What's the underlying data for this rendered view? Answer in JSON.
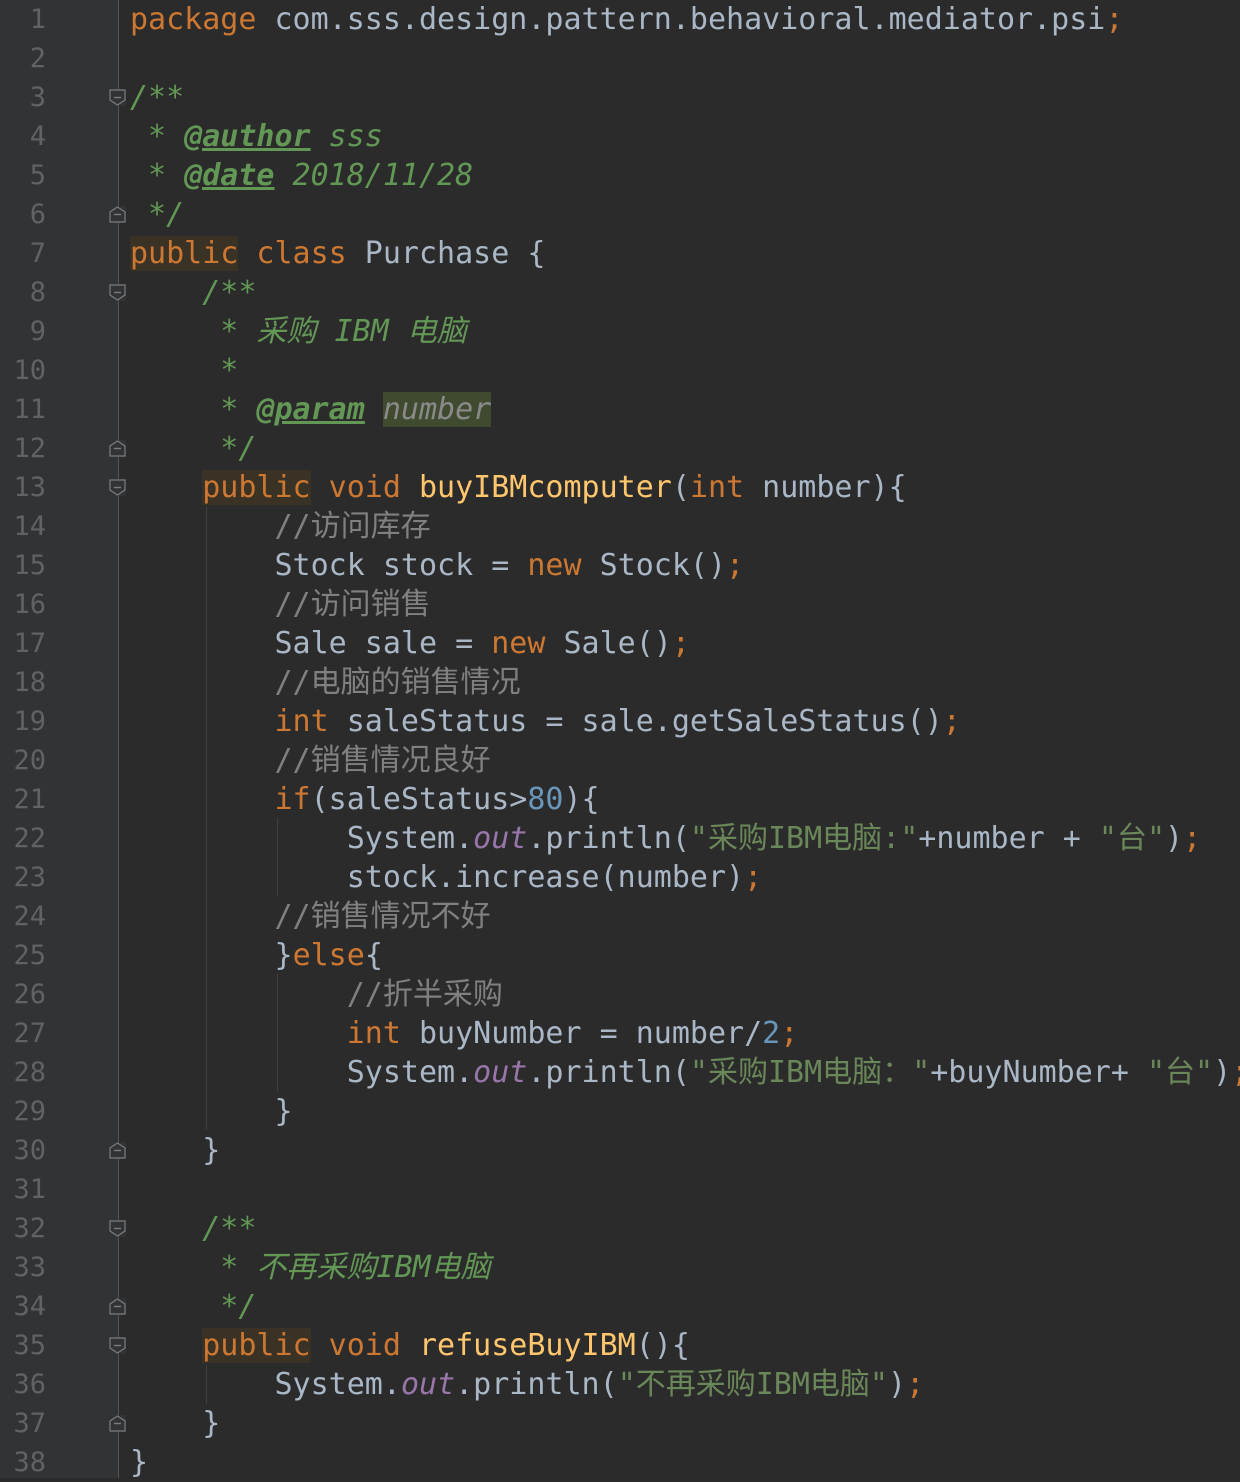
{
  "editor": {
    "line_numbers": [
      "1",
      "2",
      "3",
      "4",
      "5",
      "6",
      "7",
      "8",
      "9",
      "10",
      "11",
      "12",
      "13",
      "14",
      "15",
      "16",
      "17",
      "18",
      "19",
      "20",
      "21",
      "22",
      "23",
      "24",
      "25",
      "26",
      "27",
      "28",
      "29",
      "30",
      "31",
      "32",
      "33",
      "34",
      "35",
      "36",
      "37",
      "38"
    ],
    "lines": {
      "l1": {
        "kw_package": "package",
        "pkg_name": " com.sss.design.pattern.behavioral.mediator.psi",
        "semi": ";"
      },
      "l3": {
        "doc_open": "/**"
      },
      "l4": {
        "star": " * ",
        "tag_author": "@author",
        "author_val": " sss"
      },
      "l5": {
        "star": " * ",
        "tag_date": "@date",
        "date_val": " 2018/11/28"
      },
      "l6": {
        "doc_close": " */"
      },
      "l7": {
        "kw_public": "public",
        "kw_class": " class",
        "class_name": " Purchase {"
      },
      "l8": {
        "doc_open": "    /**"
      },
      "l9": {
        "doc_text": "     * 采购 IBM 电脑"
      },
      "l10": {
        "doc_text": "     *"
      },
      "l11": {
        "star": "     * ",
        "tag_param": "@param",
        "space": " ",
        "param_name": "number"
      },
      "l12": {
        "doc_close": "     */"
      },
      "l13": {
        "indent": "    ",
        "kw_public": "public",
        "kw_void": " void ",
        "method": "buyIBMcomputer",
        "paren_open": "(",
        "kw_int": "int",
        "params": " number){"
      },
      "l14": {
        "comment": "        //访问库存"
      },
      "l15": {
        "code": "        Stock stock = ",
        "kw_new": "new",
        "code2": " Stock()",
        "semi": ";"
      },
      "l16": {
        "comment": "        //访问销售"
      },
      "l17": {
        "code": "        Sale sale = ",
        "kw_new": "new",
        "code2": " Sale()",
        "semi": ";"
      },
      "l18": {
        "comment": "        //电脑的销售情况"
      },
      "l19": {
        "indent": "        ",
        "kw_int": "int",
        "code": " saleStatus = sale.getSaleStatus()",
        "semi": ";"
      },
      "l20": {
        "comment": "        //销售情况良好"
      },
      "l21": {
        "indent": "        ",
        "kw_if": "if",
        "code": "(saleStatus>",
        "num": "80",
        "code2": "){"
      },
      "l22": {
        "code": "            System.",
        "field": "out",
        "code2": ".println(",
        "str1": "\"采购IBM电脑:\"",
        "code3": "+number + ",
        "str2": "\"台\"",
        "code4": ")",
        "semi": ";"
      },
      "l23": {
        "code": "            stock.increase(number)",
        "semi": ";"
      },
      "l24": {
        "comment": "        //销售情况不好"
      },
      "l25": {
        "code": "        }",
        "kw_else": "else",
        "code2": "{"
      },
      "l26": {
        "comment": "            //折半采购"
      },
      "l27": {
        "indent": "            ",
        "kw_int": "int",
        "code": " buyNumber = number/",
        "num": "2",
        "semi": ";"
      },
      "l28": {
        "code": "            System.",
        "field": "out",
        "code2": ".println(",
        "str1": "\"采购IBM电脑：\"",
        "code3": "+buyNumber+ ",
        "str2": "\"台\"",
        "code4": ")",
        "semi": ";"
      },
      "l29": {
        "code": "        }"
      },
      "l30": {
        "code": "    }"
      },
      "l32": {
        "doc_open": "    /**"
      },
      "l33": {
        "star": "     * 不再采购",
        "doc_ibm": "IBM",
        "doc_rest": "电脑"
      },
      "l34": {
        "doc_close": "     */"
      },
      "l35": {
        "indent": "    ",
        "kw_public": "public",
        "kw_void": " void ",
        "method": "refuseBuyIBM",
        "params": "(){"
      },
      "l36": {
        "code": "        System.",
        "field": "out",
        "code2": ".println(",
        "str1": "\"不再采购IBM电脑\"",
        "code3": ")",
        "semi": ";"
      },
      "l37": {
        "code": "    }"
      },
      "l38": {
        "code": "}"
      }
    }
  },
  "colors": {
    "background": "#2b2b2b",
    "gutter": "#313335",
    "keyword": "#cc7832",
    "javadoc": "#629755",
    "comment": "#808080",
    "method": "#ffc66d",
    "number": "#6897bb",
    "string": "#6a8759",
    "field": "#9876aa",
    "text": "#a9b7c6"
  }
}
